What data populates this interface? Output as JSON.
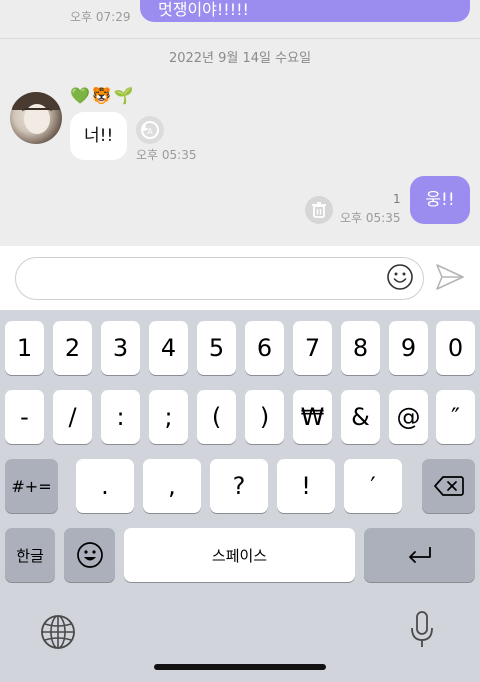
{
  "chat": {
    "top_message_text": "멋쟁이야!!!!!",
    "top_message_time": "오후 07:29",
    "date_separator": "2022년 9월 14일 수요일",
    "incoming": {
      "emojis": "💚🐯🌱",
      "text": "너!!",
      "time": "오후 05:35"
    },
    "outgoing": {
      "text": "웅!!",
      "read_count": "1",
      "time": "오후 05:35"
    }
  },
  "input": {
    "placeholder": ""
  },
  "keyboard": {
    "row1": [
      "1",
      "2",
      "3",
      "4",
      "5",
      "6",
      "7",
      "8",
      "9",
      "0"
    ],
    "row2": [
      "-",
      "/",
      ":",
      ";",
      "(",
      ")",
      "₩",
      "&",
      "@",
      "″"
    ],
    "row3_symbols_label": "#+=",
    "row3": [
      ".",
      ",",
      "?",
      "!",
      "′"
    ],
    "lang_key": "한글",
    "space_label": "스페이스"
  },
  "icons": {
    "reply": "reply-icon",
    "trash": "trash-icon",
    "emoji": "smiley-icon",
    "send": "send-icon",
    "backspace": "backspace-icon",
    "return": "return-icon",
    "globe": "globe-icon",
    "mic": "microphone-icon"
  },
  "colors": {
    "bubble_out": "#9b8cef",
    "chat_bg": "#ededed",
    "keyboard_bg": "#d1d4da"
  }
}
